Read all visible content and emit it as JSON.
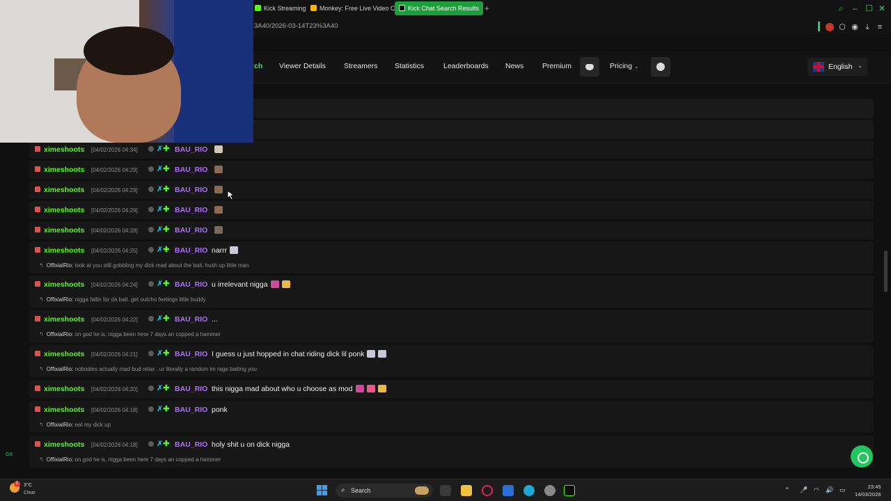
{
  "browser": {
    "tabs": [
      {
        "label": "Kick Streaming",
        "fav": "#53fc18"
      },
      {
        "label": "Monkey: Free Live Video C",
        "fav": "#f7b500"
      },
      {
        "label": "Kick Chat Search Results",
        "fav": "#0d0d0d"
      }
    ],
    "url": "3A40/2026-03-14T23%3A40",
    "accent": "#2ecc71"
  },
  "nav": {
    "partial": "ch",
    "links": [
      "Viewer Details",
      "Streamers",
      "Statistics",
      "Leaderboards",
      "News",
      "Premium"
    ],
    "pricing": "Pricing",
    "language": "English"
  },
  "chat": [
    {
      "user": "ximeshoots",
      "ts": "[04/02/2026 04:34]",
      "to": "BAU_RIO",
      "text": "",
      "emoji": [
        "#cfc8b8"
      ],
      "reply_user": "",
      "reply_text": ""
    },
    {
      "user": "ximeshoots",
      "ts": "[04/02/2026 04:29]",
      "to": "BAU_RIO",
      "text": "",
      "emoji": [
        "#8a6a50"
      ],
      "reply_user": "",
      "reply_text": ""
    },
    {
      "user": "ximeshoots",
      "ts": "[04/02/2026 04:29]",
      "to": "BAU_RIO",
      "text": "",
      "emoji": [
        "#8a6a50"
      ],
      "reply_user": "",
      "reply_text": ""
    },
    {
      "user": "ximeshoots",
      "ts": "[04/02/2026 04:29]",
      "to": "BAU_RIO",
      "text": "",
      "emoji": [
        "#8a6a50"
      ],
      "reply_user": "",
      "reply_text": ""
    },
    {
      "user": "ximeshoots",
      "ts": "[04/02/2026 04:28]",
      "to": "BAU_RIO",
      "text": "",
      "emoji": [
        "#7a6a5a"
      ],
      "reply_user": "",
      "reply_text": ""
    },
    {
      "user": "ximeshoots",
      "ts": "[04/02/2026 04:25]",
      "to": "BAU_RIO",
      "text": "narrr",
      "emoji": [
        "#c8c8d8"
      ],
      "reply_user": "OffixialRio:",
      "reply_text": "look at you still gobbling my dick mad about the bait. hush up little man"
    },
    {
      "user": "ximeshoots",
      "ts": "[04/02/2026 04:24]",
      "to": "BAU_RIO",
      "text": "u irrelevant nigga",
      "emoji": [
        "#d04a9a",
        "#e8b84a"
      ],
      "reply_user": "OffixialRio:",
      "reply_text": "nigga fallin for da bait. get outcho feelings little buddy"
    },
    {
      "user": "ximeshoots",
      "ts": "[04/02/2026 04:22]",
      "to": "BAU_RIO",
      "text": "...",
      "emoji": [],
      "reply_user": "OffixialRio:",
      "reply_text": "on god he is, nigga been here 7 days an copped a hammer"
    },
    {
      "user": "ximeshoots",
      "ts": "[04/02/2026 04:21]",
      "to": "BAU_RIO",
      "text": "I guess u just hopped in chat riding dick lil ponk",
      "emoji": [
        "#c8c8d8",
        "#c8c8d8"
      ],
      "reply_user": "OffixialRio:",
      "reply_text": "nobodies actually mad bud relax . ur literally a random im rage baiting you"
    },
    {
      "user": "ximeshoots",
      "ts": "[04/02/2026 04:20]",
      "to": "BAU_RIO",
      "text": "this nigga mad about who u choose as mod",
      "emoji": [
        "#d04a9a",
        "#e85a8a",
        "#e8b84a"
      ],
      "reply_user": "",
      "reply_text": ""
    },
    {
      "user": "ximeshoots",
      "ts": "[04/02/2026 04:18]",
      "to": "BAU_RIO",
      "text": "ponk",
      "emoji": [],
      "reply_user": "OffixialRio:",
      "reply_text": "eat my dick up"
    },
    {
      "user": "ximeshoots",
      "ts": "[04/02/2026 04:18]",
      "to": "BAU_RIO",
      "text": "holy shit u on dick nigga",
      "emoji": [],
      "reply_user": "OffixialRio:",
      "reply_text": "on god he is, nigga been here 7 days an copped a hammer"
    }
  ],
  "taskbar": {
    "temp": "3°C",
    "condition": "Clear",
    "search": "Search",
    "time": "23:45",
    "date": "14/03/2026",
    "notif": "1"
  },
  "side_label": "GX"
}
